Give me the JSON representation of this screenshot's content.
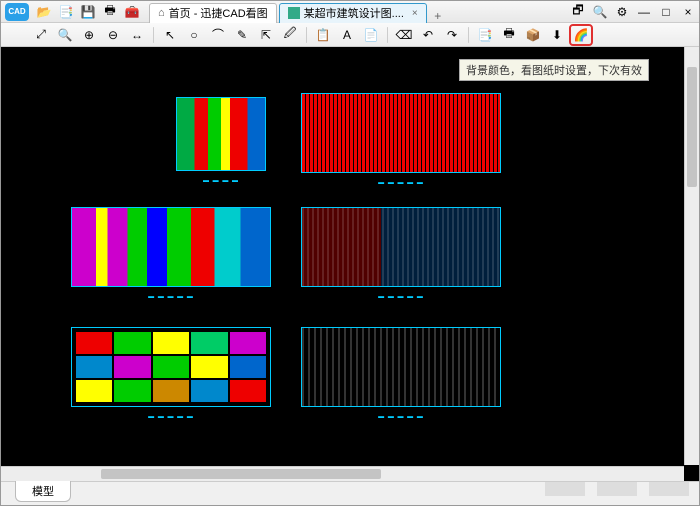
{
  "app": {
    "logo_text": "CAD"
  },
  "titlebar_icons": {
    "open": "📂",
    "convert": "📑",
    "save": "💾",
    "print": "🖶",
    "tools": "🧰"
  },
  "tabs": {
    "home": "首页 - 迅捷CAD看图",
    "doc": "某超市建筑设计图....",
    "close": "×",
    "new": "+"
  },
  "window_controls": {
    "batch": "🗗",
    "zoom": "🔍",
    "settings": "⚙",
    "min": "—",
    "max": "□",
    "close": "×"
  },
  "toolbar": {
    "t1": "⤢",
    "t2": "🔍",
    "t3": "⊕",
    "t4": "⊖",
    "t5": "↔",
    "t6": "↖",
    "t7": "○",
    "t8": "⌒",
    "t9": "✎",
    "t10": "⇱",
    "t11": "🖉",
    "t12": "📋",
    "t13": "A",
    "t14": "📄",
    "t15": "⌫",
    "t16": "↶",
    "t17": "↷",
    "t18": "📑",
    "t19": "🖶",
    "t20": "📦",
    "t21": "⬇",
    "t22": "🌈"
  },
  "tooltip": "背景颜色，看图纸时设置，下次有效",
  "captions": {
    "c1": "▬ ▬ ▬ ▬",
    "c2": "▬ ▬ ▬ ▬ ▬",
    "c3": "▬ ▬ ▬ ▬ ▬",
    "c4": "▬ ▬ ▬ ▬ ▬",
    "c5": "▬ ▬ ▬ ▬ ▬",
    "c6": "▬ ▬ ▬ ▬ ▬"
  },
  "bottom_tab": "模型"
}
